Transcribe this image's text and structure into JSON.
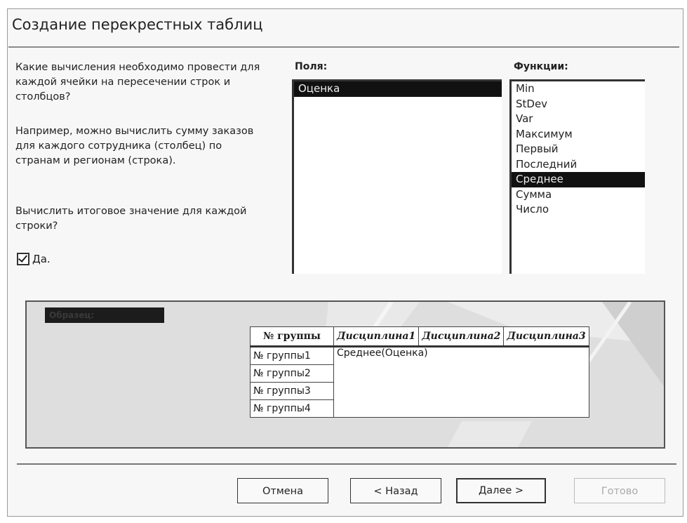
{
  "window": {
    "title": "Создание перекрестных таблиц"
  },
  "instructions": {
    "question": "Какие вычисления необходимо провести для каждой ячейки на пересечении строк и столбцов?",
    "example": "Например, можно вычислить сумму заказов для каждого сотрудника (столбец) по странам и регионам (строка).",
    "row_summary_question": "Вычислить итоговое значение для каждой строки?"
  },
  "row_summary_checkbox": {
    "label": "Да.",
    "checked": true
  },
  "fields": {
    "label": "Поля:",
    "items": [
      "Оценка"
    ],
    "selected": "Оценка"
  },
  "functions": {
    "label": "Функции:",
    "items": [
      "Min",
      "StDev",
      "Var",
      "Максимум",
      "Первый",
      "Последний",
      "Среднее",
      "Сумма",
      "Число"
    ],
    "selected": "Среднее"
  },
  "sample": {
    "label": "Образец:",
    "header": [
      "№ группы",
      "Дисциплина1",
      "Дисциплина2",
      "Дисциплина3"
    ],
    "row_headers": [
      "№ группы1",
      "№ группы2",
      "№ группы3",
      "№ группы4"
    ],
    "value_cell": "Среднее(Оценка)"
  },
  "buttons": {
    "cancel": "Отмена",
    "back": "< Назад",
    "next": "Далее >",
    "finish": "Готово"
  }
}
